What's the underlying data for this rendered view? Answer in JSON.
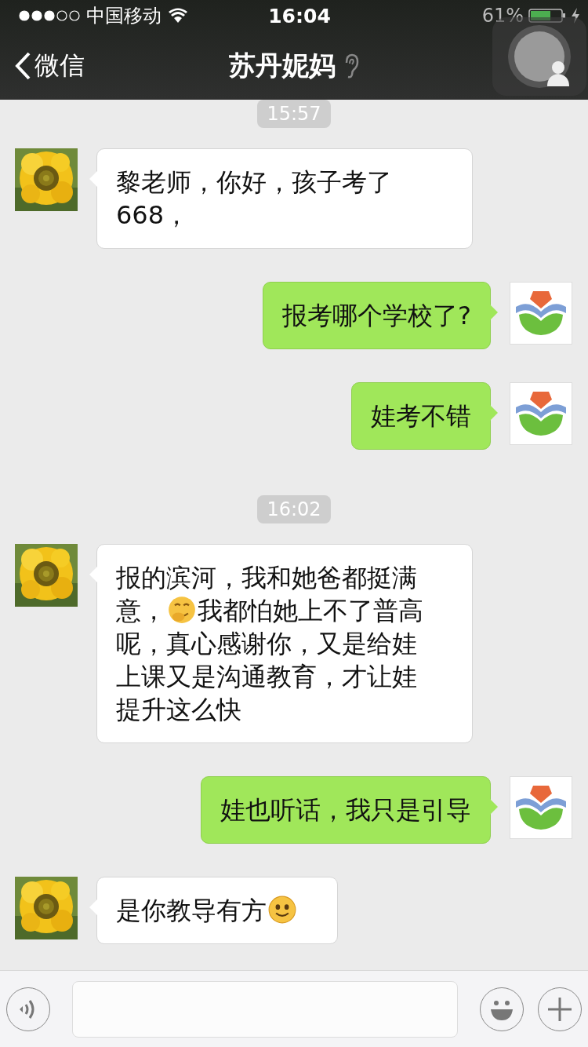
{
  "status_bar": {
    "carrier": "中国移动",
    "time": "16:04",
    "battery": "61%"
  },
  "nav": {
    "back": "微信",
    "title": "苏丹妮妈"
  },
  "messages": [
    {
      "kind": "time",
      "text": "15:57"
    },
    {
      "kind": "in",
      "parts": [
        {
          "kind": "text",
          "text": "黎老师，你好，孩子考了668，"
        }
      ]
    },
    {
      "kind": "out",
      "parts": [
        {
          "kind": "text",
          "text": "报考哪个学校了?"
        }
      ]
    },
    {
      "kind": "out",
      "parts": [
        {
          "kind": "text",
          "text": "娃考不错"
        }
      ]
    },
    {
      "kind": "time",
      "text": "16:02"
    },
    {
      "kind": "in",
      "parts": [
        {
          "kind": "text",
          "text": "报的滨河，我和她爸都挺满意，"
        },
        {
          "kind": "hug"
        },
        {
          "kind": "text",
          "text": "我都怕她上不了普高呢，真心感谢你，又是给娃上课又是沟通教育，才让娃提升这么快"
        }
      ]
    },
    {
      "kind": "out",
      "parts": [
        {
          "kind": "text",
          "text": "娃也听话，我只是引导"
        }
      ]
    },
    {
      "kind": "in",
      "parts": [
        {
          "kind": "text",
          "text": "是你教导有方"
        },
        {
          "kind": "smile"
        }
      ]
    }
  ]
}
